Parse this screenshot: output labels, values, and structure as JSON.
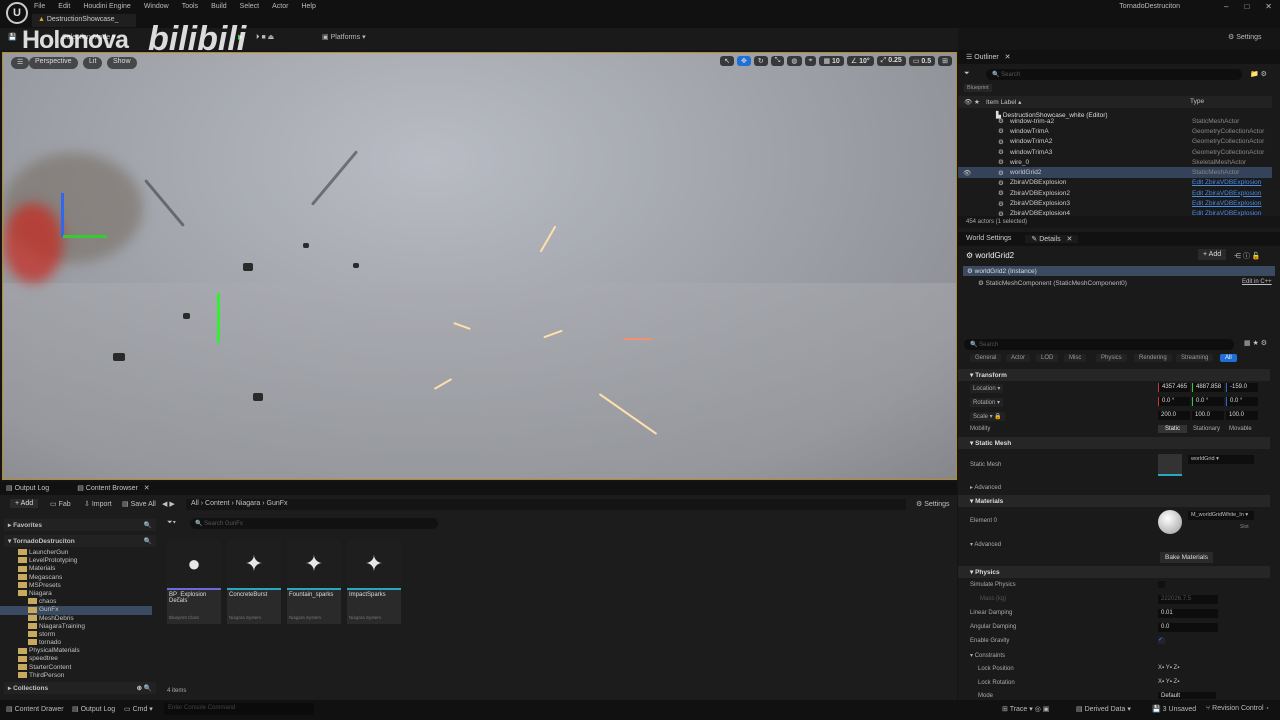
{
  "app": {
    "title": "TornadoDestruciton",
    "document_tab": "DestructionShowcase_",
    "menu": [
      "File",
      "Edit",
      "Houdini Engine",
      "Window",
      "Tools",
      "Build",
      "Select",
      "Actor",
      "Help"
    ],
    "window_controls": [
      "minimize",
      "maximize",
      "close"
    ]
  },
  "watermark": {
    "text1": "Holonova",
    "text2": "bilibili"
  },
  "toolbar": {
    "selection_mode": "Selection Mode",
    "platforms": "Platforms",
    "settings": "Settings"
  },
  "viewport": {
    "perspective": "Perspective",
    "lit": "Lit",
    "show": "Show",
    "grid_snap": "10",
    "rotation_snap": "10°",
    "scale_snap": "0.25",
    "camera_speed": "0.5"
  },
  "outliner": {
    "tab": "Outliner",
    "search_placeholder": "Search",
    "filter_chip": "Blueprint",
    "col_label": "Item Label ▴",
    "col_type": "Type",
    "root": "DestructionShowcase_white (Editor)",
    "items": [
      {
        "label": "window-trim-a2",
        "type": "StaticMeshActor"
      },
      {
        "label": "windowTrimA",
        "type": "GeometryCollectionActor"
      },
      {
        "label": "windowTrimA2",
        "type": "GeometryCollectionActor"
      },
      {
        "label": "windowTrimA3",
        "type": "GeometryCollectionActor"
      },
      {
        "label": "wire_0",
        "type": "SkeletalMeshActor"
      },
      {
        "label": "worldGrid2",
        "type": "StaticMeshActor",
        "selected": true
      },
      {
        "label": "ZbiraVDBExplosion",
        "type": "Edit ZbiraVDBExplosion",
        "link": true
      },
      {
        "label": "ZbiraVDBExplosion2",
        "type": "Edit ZbiraVDBExplosion",
        "link": true
      },
      {
        "label": "ZbiraVDBExplosion3",
        "type": "Edit ZbiraVDBExplosion",
        "link": true
      },
      {
        "label": "ZbiraVDBExplosion4",
        "type": "Edit ZbiraVDBExplosion",
        "link": true
      }
    ],
    "footer": "454 actors (1 selected)"
  },
  "details": {
    "tabs": [
      "World Settings",
      "Details"
    ],
    "actor_name": "worldGrid2",
    "add": "+ Add",
    "instance": "worldGrid2 (Instance)",
    "component": "StaticMeshComponent (StaticMeshComponent0)",
    "edit_cpp": "Edit in C++",
    "search_placeholder": "Search",
    "categories": [
      "General",
      "Actor",
      "LOD",
      "Misc",
      "Physics",
      "Rendering",
      "Streaming",
      "All"
    ],
    "active_category": "All",
    "transform": {
      "header": "Transform",
      "location_label": "Location",
      "location": [
        "4357.465",
        "4887.858",
        "-159.0"
      ],
      "rotation_label": "Rotation",
      "rotation": [
        "0.0 °",
        "0.0 °",
        "0.0 °"
      ],
      "scale_label": "Scale",
      "scale": [
        "200.0",
        "100.0",
        "100.0"
      ],
      "mobility_label": "Mobility",
      "mobility": [
        "Static",
        "Stationary",
        "Movable"
      ],
      "mobility_selected": "Static"
    },
    "static_mesh": {
      "header": "Static Mesh",
      "label": "Static Mesh",
      "value": "worldGrid",
      "advanced": "Advanced"
    },
    "materials": {
      "header": "Materials",
      "element_label": "Element 0",
      "value": "M_worldGridWhite_In",
      "slot": "Slot",
      "advanced": "Advanced",
      "bake": "Bake Materials"
    },
    "physics": {
      "header": "Physics",
      "simulate": "Simulate Physics",
      "mass": "Mass (kg)",
      "mass_value": "222026.7.5",
      "linear_label": "Linear Damping",
      "linear": "0.01",
      "angular_label": "Angular Damping",
      "angular": "0.0",
      "gravity": "Enable Gravity",
      "constraints": "Constraints",
      "lock_pos": "Lock Position",
      "lock_rot": "Lock Rotation",
      "mode": "Mode",
      "mode_value": "Default",
      "axes": [
        "X",
        "Y",
        "Z"
      ]
    }
  },
  "content_browser": {
    "tabs": [
      "Output Log",
      "Content Browser"
    ],
    "add": "+ Add",
    "fab": "Fab",
    "import": "Import",
    "save_all": "Save All",
    "breadcrumb": [
      "All",
      "Content",
      "Niagara",
      "GunFx"
    ],
    "settings": "Settings",
    "favorites": "Favorites",
    "project": "TornadoDestruciton",
    "collections": "Collections",
    "search_placeholder": "Search GunFx",
    "count": "4 items",
    "folders": [
      {
        "name": "LauncherGun",
        "lvl": 1
      },
      {
        "name": "LevelPrototyping",
        "lvl": 1
      },
      {
        "name": "Materials",
        "lvl": 1
      },
      {
        "name": "Megascans",
        "lvl": 1
      },
      {
        "name": "MSPresets",
        "lvl": 1
      },
      {
        "name": "Niagara",
        "lvl": 1
      },
      {
        "name": "chaos",
        "lvl": 2
      },
      {
        "name": "GunFx",
        "lvl": 2,
        "selected": true
      },
      {
        "name": "MeshDebris",
        "lvl": 2
      },
      {
        "name": "NiagaraTraining",
        "lvl": 2
      },
      {
        "name": "storm",
        "lvl": 2
      },
      {
        "name": "tornado",
        "lvl": 2
      },
      {
        "name": "PhysicalMaterials",
        "lvl": 1
      },
      {
        "name": "speedtree",
        "lvl": 1
      },
      {
        "name": "StarterContent",
        "lvl": 1
      },
      {
        "name": "ThirdPerson",
        "lvl": 1
      }
    ],
    "assets": [
      {
        "name": "BP_Explosion Decals",
        "kind": "Blueprint Class",
        "icon": "sphere-icon"
      },
      {
        "name": "ConcreteBurst",
        "kind": "Niagara System",
        "icon": "stars-icon"
      },
      {
        "name": "Fountain_sparks",
        "kind": "Niagara System",
        "icon": "stars-icon"
      },
      {
        "name": "ImpactSparks",
        "kind": "Niagara System",
        "icon": "stars-icon"
      }
    ]
  },
  "statusbar": {
    "content_drawer": "Content Drawer",
    "output_log": "Output Log",
    "cmd": "Cmd",
    "console_placeholder": "Enter Console Command",
    "trace": "Trace",
    "derived_data": "Derived Data",
    "unsaved": "3 Unsaved",
    "revision": "Revision Control"
  }
}
